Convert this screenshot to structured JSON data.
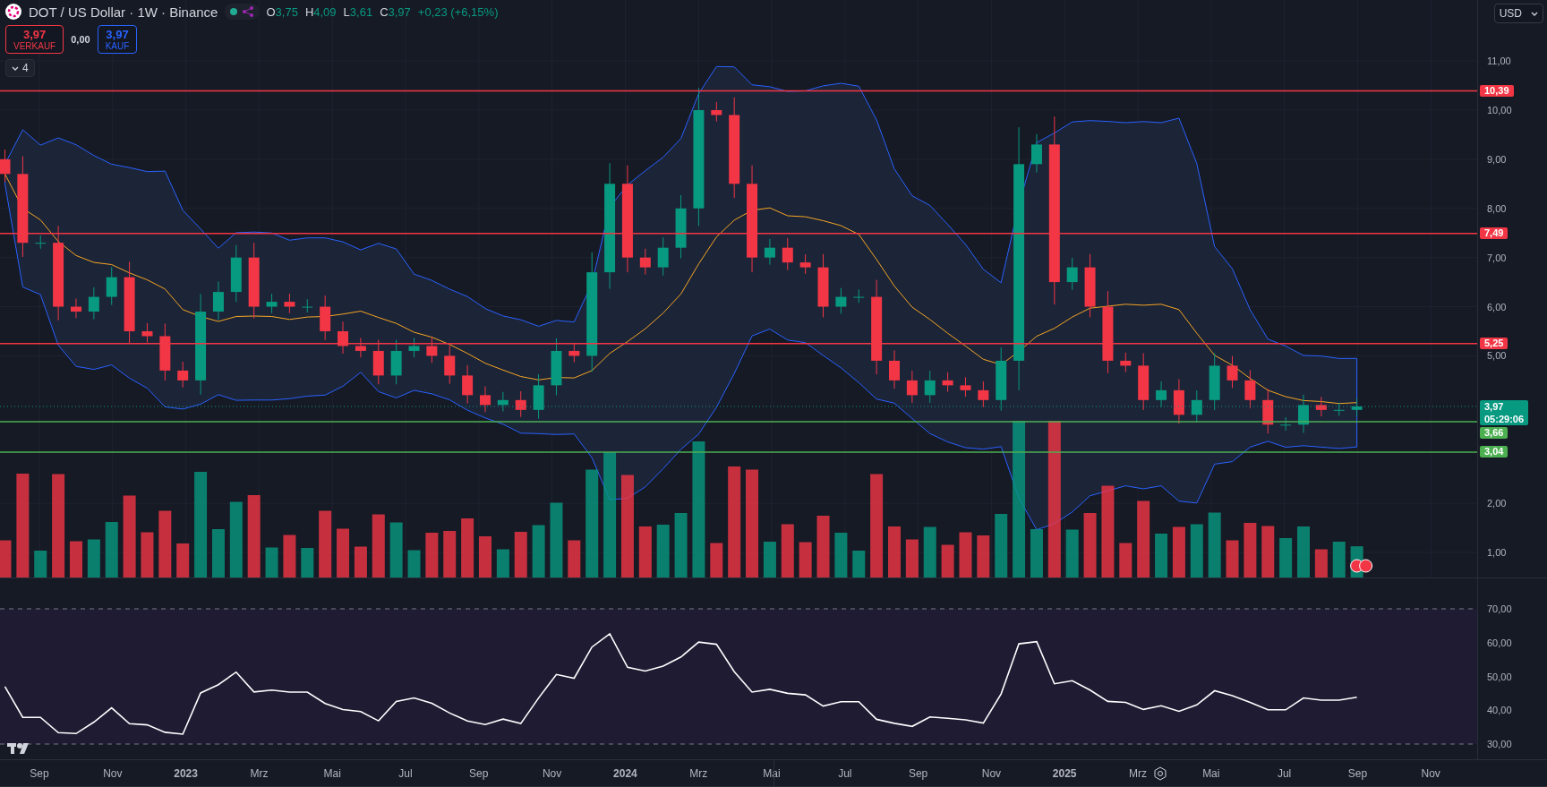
{
  "header": {
    "title": "DOT / US Dollar · 1W · Binance",
    "ohlc": [
      {
        "letter": "O",
        "value": "3,75"
      },
      {
        "letter": "H",
        "value": "4,09"
      },
      {
        "letter": "L",
        "value": "3,61"
      },
      {
        "letter": "C",
        "value": "3,97"
      }
    ],
    "change": "+0,23 (+6,15%)"
  },
  "trade": {
    "sell": {
      "price": "3,97",
      "label": "VERKAUF"
    },
    "spread": "0,00",
    "buy": {
      "price": "3,97",
      "label": "KAUF"
    }
  },
  "indicators_toggle": {
    "count": "4",
    "expanded": false
  },
  "currency": "USD",
  "price_axis": [
    "11,00",
    "10,00",
    "9,00",
    "8,00",
    "7,00",
    "6,00",
    "5,00",
    "2,00",
    "1,00"
  ],
  "price_levels": [
    {
      "label": "10,39",
      "color": "#f23645"
    },
    {
      "label": "7,49",
      "color": "#f23645"
    },
    {
      "label": "5,25",
      "color": "#f23645"
    },
    {
      "label": "3,66",
      "color": "#4caf50"
    },
    {
      "label": "3,04",
      "color": "#4caf50"
    }
  ],
  "last_price": {
    "label": "3,97",
    "countdown": "05:29:06",
    "color": "#089981"
  },
  "rsi_axis": [
    "70,00",
    "60,00",
    "50,00",
    "40,00",
    "30,00"
  ],
  "time_axis": [
    {
      "label": "Sep",
      "kind": "month"
    },
    {
      "label": "Nov",
      "kind": "month"
    },
    {
      "label": "2023",
      "kind": "year"
    },
    {
      "label": "Mrz",
      "kind": "month"
    },
    {
      "label": "Mai",
      "kind": "month"
    },
    {
      "label": "Jul",
      "kind": "month"
    },
    {
      "label": "Sep",
      "kind": "month"
    },
    {
      "label": "Nov",
      "kind": "month"
    },
    {
      "label": "2024",
      "kind": "year"
    },
    {
      "label": "Mrz",
      "kind": "month"
    },
    {
      "label": "Mai",
      "kind": "month"
    },
    {
      "label": "Jul",
      "kind": "month"
    },
    {
      "label": "Sep",
      "kind": "month"
    },
    {
      "label": "Nov",
      "kind": "month"
    },
    {
      "label": "2025",
      "kind": "year"
    },
    {
      "label": "Mrz",
      "kind": "month"
    },
    {
      "label": "Mai",
      "kind": "month"
    },
    {
      "label": "Jul",
      "kind": "month"
    },
    {
      "label": "Sep",
      "kind": "month"
    },
    {
      "label": "Nov",
      "kind": "month"
    }
  ]
}
